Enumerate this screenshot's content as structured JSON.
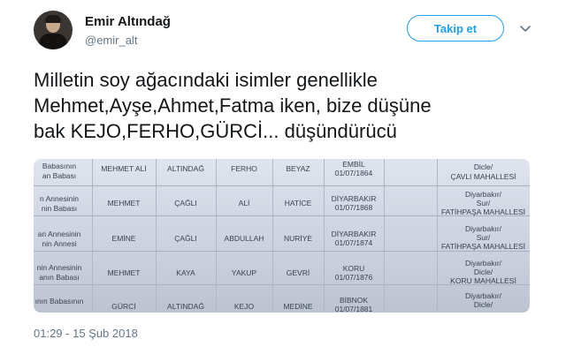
{
  "user": {
    "name": "Emir Altındağ",
    "handle": "@emir_alt"
  },
  "follow_label": "Takip et",
  "tweet": {
    "text": "Milletin soy ağacındaki isimler genellikle\nMehmet,Ayşe,Ahmet,Fatma iken, bize düşüne\nbak KEJO,FERHO,GÜRCİ... düşündürücü",
    "timestamp": "01:29 - 15 Şub 2018"
  },
  "photo_rows": [
    {
      "relation_top": "Babasının",
      "relation_bottom": "an Babası",
      "name": "MEHMET ALİ",
      "surname": "ALTINDAĞ",
      "father": "FERHO",
      "mother": "BEYAZ",
      "place": "EMBİL",
      "date": "01/07/1864",
      "address_l1": "Dicle/",
      "address_l2": "ÇAVLI MAHALLESİ",
      "address_l3": ""
    },
    {
      "relation_top": "n Annesinin",
      "relation_bottom": "nin Babası",
      "name": "MEHMET",
      "surname": "ÇAĞLI",
      "father": "ALİ",
      "mother": "HATİCE",
      "place": "DİYARBAKIR",
      "date": "01/07/1868",
      "address_l1": "Diyarbakır/",
      "address_l2": "Sur/",
      "address_l3": "FATİHPAŞA MAHALLESİ"
    },
    {
      "relation_top": "an Annesinin",
      "relation_bottom": "nin Annesi",
      "name": "EMİNE",
      "surname": "ÇAĞLI",
      "father": "ABDULLAH",
      "mother": "NURİYE",
      "place": "DİYARBAKIR",
      "date": "01/07/1874",
      "address_l1": "Diyarbakır/",
      "address_l2": "Sur/",
      "address_l3": "FATİHPAŞA MAHALLESİ"
    },
    {
      "relation_top": "nin Annesinin",
      "relation_bottom": "anın Babası",
      "name": "MEHMET",
      "surname": "KAYA",
      "father": "YAKUP",
      "mother": "GEVRİ",
      "place": "KORU",
      "date": "01/07/1876",
      "address_l1": "Diyarbakır/",
      "address_l2": "Dicle/",
      "address_l3": "KORU MAHALLESİ"
    },
    {
      "relation_top": "ının Babasının",
      "relation_bottom": "",
      "name": "GÜRCİ",
      "surname": "ALTINDAĞ",
      "father": "KEJO",
      "mother": "MEDİNE",
      "place": "BİBNOK",
      "date": "01/07/1881",
      "address_l1": "Diyarbakır/",
      "address_l2": "Dicle/",
      "address_l3": ""
    }
  ],
  "icons": {
    "more": "chevron-down-icon"
  },
  "colors": {
    "accent": "#1da1f2",
    "muted": "#657786"
  }
}
